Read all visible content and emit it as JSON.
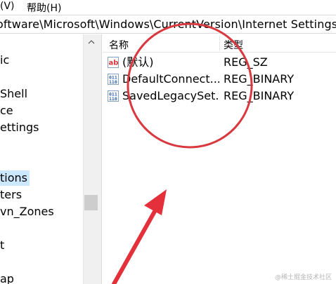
{
  "menubar": {
    "items": [
      {
        "label": "(V)"
      },
      {
        "label": "帮助(H)"
      }
    ]
  },
  "address": {
    "path": "oftware\\Microsoft\\Windows\\CurrentVersion\\Internet Settings\\"
  },
  "tree": {
    "items": [
      {
        "label": "ic"
      },
      {
        "label": "Shell"
      },
      {
        "label": "ce"
      },
      {
        "label": "ettings"
      },
      {
        "label": "tions"
      },
      {
        "label": "ters"
      },
      {
        "label": "vn_Zones"
      },
      {
        "label": "t"
      },
      {
        "label": "ap"
      }
    ],
    "selected_index": 4,
    "scroll_up_icon": "chevron-up-icon"
  },
  "list": {
    "columns": [
      {
        "label": "名称"
      },
      {
        "label": "类型"
      }
    ],
    "rows": [
      {
        "icon": "string-value-icon",
        "name": "(默认)",
        "type": "REG_SZ"
      },
      {
        "icon": "binary-value-icon",
        "name": "DefaultConnect...",
        "type": "REG_BINARY"
      },
      {
        "icon": "binary-value-icon",
        "name": "SavedLegacySet...",
        "type": "REG_BINARY"
      }
    ]
  },
  "annotation": {
    "circle_color": "#d9383f",
    "arrow_color": "#e4303b"
  },
  "watermark": {
    "text": "@稀土掘金技术社区"
  },
  "colors": {
    "selection": "#cce8ff",
    "pane_background": "#ffffff",
    "scrollbar_track": "#f0f0f0"
  }
}
